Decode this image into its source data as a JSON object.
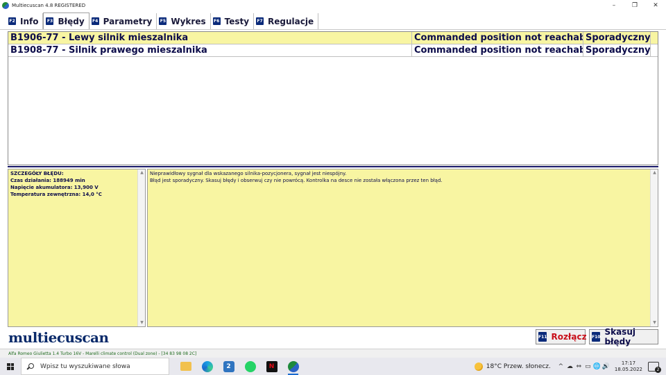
{
  "window": {
    "title": "Multiecuscan 4.8 REGISTERED",
    "controls": {
      "minimize": "–",
      "restore": "❐",
      "close": "✕"
    }
  },
  "tabs": [
    {
      "key": "F2",
      "label": "Info",
      "active": false
    },
    {
      "key": "F3",
      "label": "Błędy",
      "active": true
    },
    {
      "key": "F4",
      "label": "Parametry",
      "active": false
    },
    {
      "key": "F5",
      "label": "Wykres",
      "active": false
    },
    {
      "key": "F6",
      "label": "Testy",
      "active": false
    },
    {
      "key": "F7",
      "label": "Regulacje",
      "active": false
    }
  ],
  "faults": [
    {
      "code": "B1906-77 - Lewy silnik mieszalnika",
      "description": "Commanded position not reachable",
      "type": "Sporadyczny"
    },
    {
      "code": "B1908-77 - Silnik prawego mieszalnika",
      "description": "Commanded position not reachable",
      "type": "Sporadyczny"
    }
  ],
  "details": {
    "heading": "SZCZEGÓŁY BŁĘDU:",
    "lines": [
      "Czas działania: 188949 min",
      "Napięcie akumulatora: 13,900 V",
      "Temperatura zewnętrzna: 14,0 °C"
    ]
  },
  "explanation": {
    "lines": [
      "Nieprawidłowy sygnał dla wskazanego silnika-pozycjonera, sygnał jest niespójny.",
      "Błąd jest sporadyczny. Skasuj błędy i obserwuj czy nie powrócą. Kontrolka na desce nie została włączona przez ten błąd."
    ]
  },
  "logo": "multiecuscan",
  "buttons": {
    "disconnect": {
      "key": "F11",
      "label": "Rozłącz",
      "color": "#c8101a"
    },
    "clear": {
      "key": "F10",
      "label": "Skasuj błędy"
    }
  },
  "status": "Alfa Romeo Giulietta 1.4 Turbo 16V - Marelli climate control (Dual zone) - [34 83 98 08 2C]",
  "taskbar": {
    "search_placeholder": "Wpisz tu wyszukiwane słowa",
    "weather": "18°C  Przew. słonecz.",
    "time": "17:17",
    "date": "18.05.2022",
    "notification_count": "2",
    "tray_icons": [
      "^",
      "☁",
      "⇔",
      "▭",
      "🌐",
      "🔊"
    ],
    "apps": [
      {
        "name": "file-explorer-icon",
        "badge": ""
      },
      {
        "name": "edge-icon",
        "badge": ""
      },
      {
        "name": "app-icon",
        "badge": "2"
      },
      {
        "name": "whatsapp-icon",
        "badge": ""
      },
      {
        "name": "netflix-icon",
        "badge": "N"
      },
      {
        "name": "multiecuscan-icon",
        "badge": ""
      }
    ]
  }
}
